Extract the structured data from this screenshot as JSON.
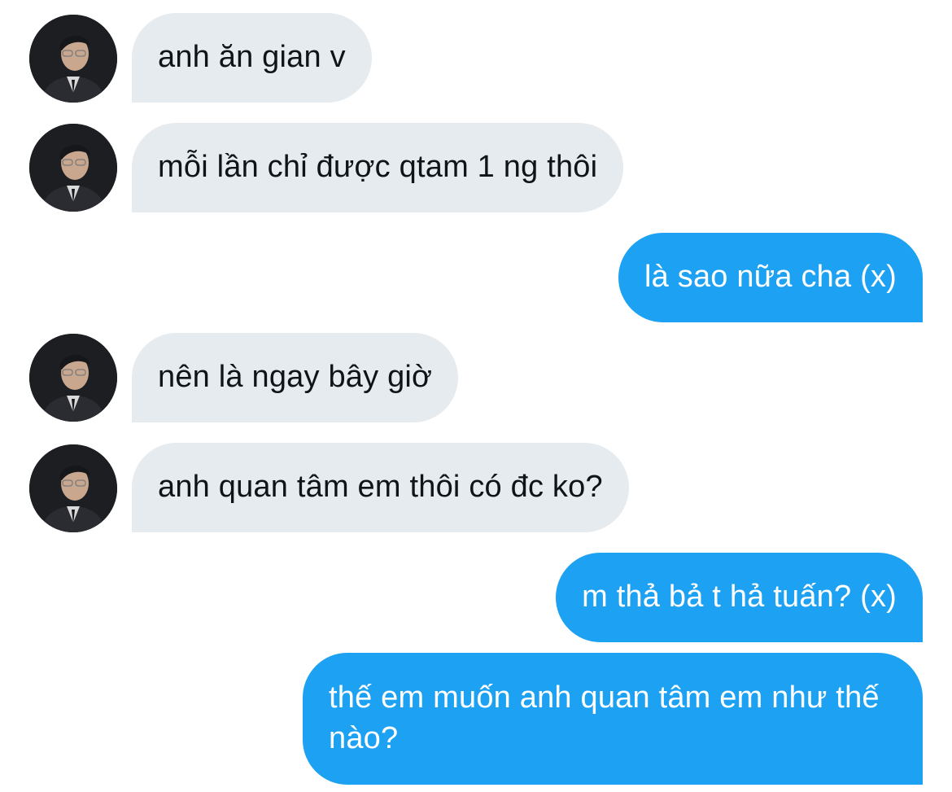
{
  "conversation": {
    "messages": [
      {
        "direction": "in",
        "text": "anh ăn gian v"
      },
      {
        "direction": "in",
        "text": "mỗi lần chỉ được qtam 1 ng thôi"
      },
      {
        "direction": "out",
        "text": "là sao nữa cha (x)"
      },
      {
        "direction": "in",
        "text": "nên là ngay bây giờ"
      },
      {
        "direction": "in",
        "text": "anh quan tâm em thôi có đc ko?"
      },
      {
        "direction": "out",
        "text": "m thả bả t hả tuấn? (x)"
      },
      {
        "direction": "out",
        "text": "thế em muốn anh quan tâm em như thế nào?"
      }
    ]
  },
  "colors": {
    "incoming_bubble": "#e6ebef",
    "outgoing_bubble": "#1da1f2",
    "incoming_text": "#0f1419",
    "outgoing_text": "#ffffff"
  },
  "icons": {
    "avatar": "user-avatar-photo"
  }
}
